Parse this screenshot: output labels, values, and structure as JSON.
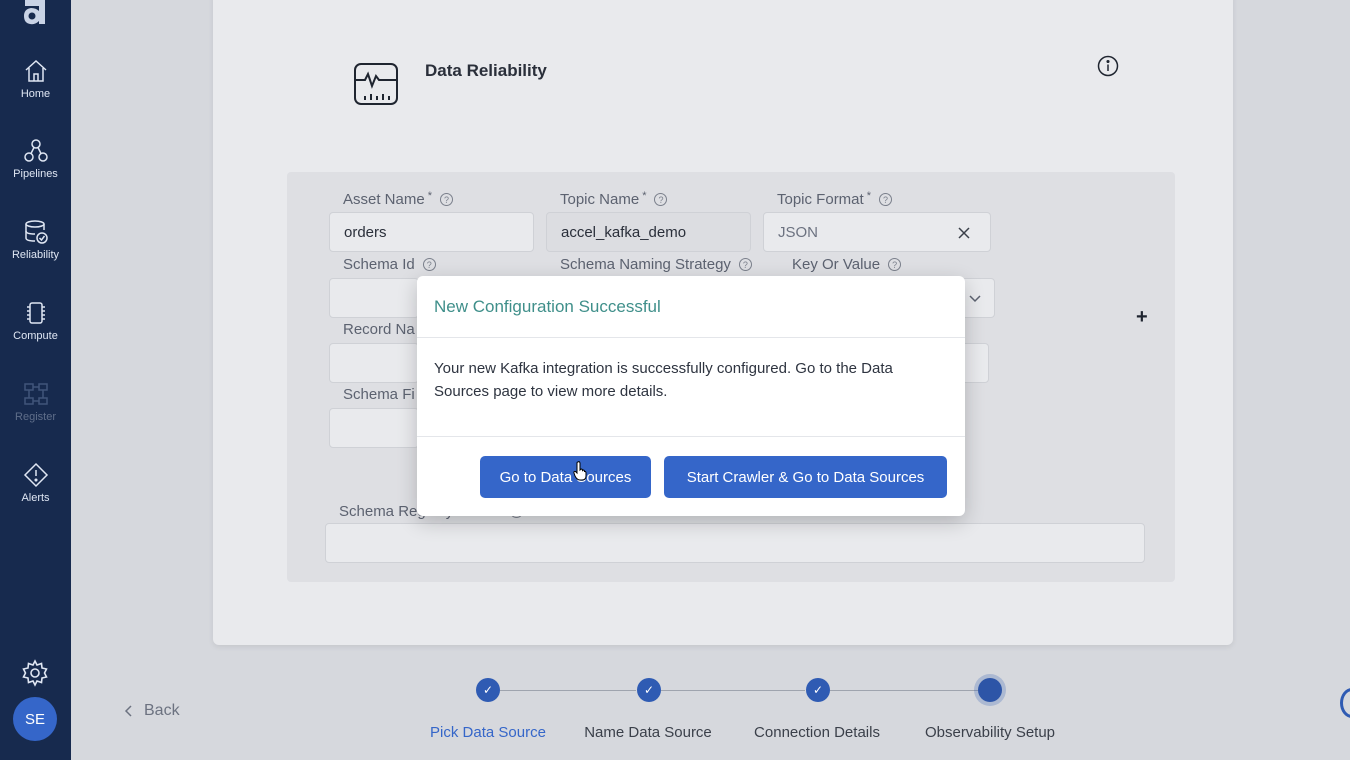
{
  "sidebar": {
    "items": [
      {
        "label": "Home",
        "icon": "home-icon"
      },
      {
        "label": "Pipelines",
        "icon": "pipelines-icon"
      },
      {
        "label": "Reliability",
        "icon": "reliability-icon"
      },
      {
        "label": "Compute",
        "icon": "compute-icon"
      },
      {
        "label": "Register",
        "icon": "register-icon"
      },
      {
        "label": "Alerts",
        "icon": "alerts-icon"
      }
    ],
    "avatar_initials": "SE"
  },
  "header": {
    "title": "Data Reliability"
  },
  "form": {
    "asset_name_label": "Asset Name",
    "asset_name_value": "orders",
    "topic_name_label": "Topic Name",
    "topic_name_value": "accel_kafka_demo",
    "topic_format_label": "Topic Format",
    "topic_format_value": "JSON",
    "schema_id_label": "Schema Id",
    "schema_naming_strategy_label": "Schema Naming Strategy",
    "key_or_value_label": "Key Or Value",
    "record_name_label": "Record Na",
    "schema_file_label": "Schema Fi",
    "schema_registry_server_label": "Schema Registry Server",
    "required_mark": "*",
    "help_mark": "?",
    "add_symbol": "+"
  },
  "modal": {
    "title": "New Configuration Successful",
    "body": "Your new Kafka integration is successfully configured. Go to the Data Sources page to view more details.",
    "primary_button": "Go to Data Sources",
    "secondary_button": "Start Crawler & Go to Data Sources"
  },
  "footer": {
    "back_label": "Back",
    "steps": [
      {
        "label": "Pick Data Source"
      },
      {
        "label": "Name Data Source"
      },
      {
        "label": "Connection Details"
      },
      {
        "label": "Observability Setup"
      }
    ],
    "check_mark": "✓"
  },
  "colors": {
    "sidebar_bg": "#172a4e",
    "accent": "#3566c9",
    "modal_title": "#3f8f8a"
  }
}
